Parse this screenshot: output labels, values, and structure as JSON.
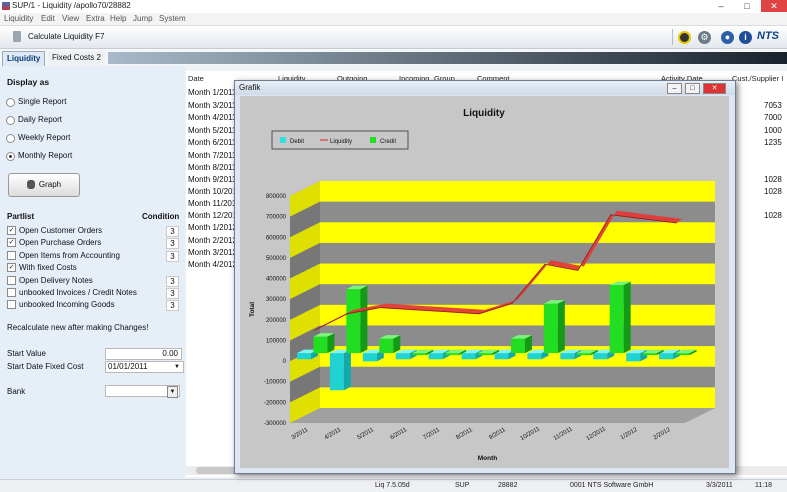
{
  "window": {
    "title": "SUP/1 - Liquidity /apollo70/28882",
    "minimize": "–",
    "maximize": "□",
    "close": "✕"
  },
  "menu": [
    "Liquidity",
    "Edit",
    "View",
    "Extra",
    "Help",
    "Jump",
    "System"
  ],
  "toolbar": {
    "command_label": "Calculate Liquidity F7",
    "brand": "NTS",
    "info_glyph": "i"
  },
  "tabs": [
    {
      "label": "Liquidity"
    },
    {
      "label": "Fixed Costs 2"
    }
  ],
  "left_panel": {
    "display_as_label": "Display as",
    "radios": [
      {
        "label": "Single Report",
        "selected": false
      },
      {
        "label": "Daily Report",
        "selected": false
      },
      {
        "label": "Weekly Report",
        "selected": false
      },
      {
        "label": "Monthly Report",
        "selected": true
      }
    ],
    "graph_button": "Graph",
    "partlist_label": "Partlist",
    "condition_label": "Condition",
    "partlist": [
      {
        "label": "Open Customer Orders",
        "checked": true,
        "condition": "3"
      },
      {
        "label": "Open Purchase Orders",
        "checked": true,
        "condition": "3"
      },
      {
        "label": "Open Items from Accounting",
        "checked": false,
        "condition": "3"
      },
      {
        "label": "With fixed Costs",
        "checked": true,
        "condition": ""
      },
      {
        "label": "Open Delivery Notes",
        "checked": false,
        "condition": "3"
      },
      {
        "label": "unbooked Invoices / Credit Notes",
        "checked": false,
        "condition": "3"
      },
      {
        "label": "unbooked Incoming Goods",
        "checked": false,
        "condition": "3"
      }
    ],
    "recalc_note": "Recalculate new after making Changes!",
    "start_value_label": "Start Value",
    "start_value": "0.00",
    "start_date_label": "Start Date Fixed Cost",
    "start_date": "01/01/2011",
    "bank_label": "Bank",
    "bank_value": ""
  },
  "table": {
    "columns": [
      "Date",
      "Liquidity",
      "Outgoing",
      "Incoming",
      "Group",
      "Comment",
      "Activity Date",
      "Cust./Supplier I"
    ],
    "rows": [
      {
        "date": "Month 1/2011",
        "cust": ""
      },
      {
        "date": "Month 3/2011",
        "cust": "7053"
      },
      {
        "date": "Month 4/2011",
        "cust": "7000"
      },
      {
        "date": "Month 5/2011",
        "cust": "1000"
      },
      {
        "date": "Month 6/2011",
        "cust": "1235"
      },
      {
        "date": "Month 7/2011",
        "cust": ""
      },
      {
        "date": "Month 8/2011",
        "cust": ""
      },
      {
        "date": "Month 9/2011",
        "cust": "1028"
      },
      {
        "date": "Month 10/2011",
        "cust": "1028"
      },
      {
        "date": "Month 11/2011",
        "cust": ""
      },
      {
        "date": "Month 12/2011",
        "cust": "1028"
      },
      {
        "date": "Month 1/2012",
        "cust": ""
      },
      {
        "date": "Month 2/2012",
        "cust": ""
      },
      {
        "date": "Month 3/2012",
        "cust": ""
      },
      {
        "date": "Month 4/2012",
        "cust": ""
      }
    ]
  },
  "status": {
    "version": "Liq 7.5.05d",
    "module": "SUP",
    "session": "28882",
    "company": "0001 NTS Software GmbH",
    "date": "3/3/2011",
    "time": "11:18"
  },
  "grafik": {
    "title": "Grafik",
    "min": "–",
    "max": "□",
    "close": "✕"
  },
  "colors": {
    "debit": "#2fe0e0",
    "liquidity": "#e03a3a",
    "credit": "#22dd22",
    "band_yellow": "#ffff00",
    "band_gray": "#8c8c8c"
  },
  "chart_data": {
    "type": "bar",
    "title": "Liquidity",
    "xlabel": "Month",
    "ylabel": "Total",
    "legend": [
      "Debit",
      "Liquidity",
      "Credit"
    ],
    "legend_position": "top-left",
    "categories": [
      "3/2011",
      "4/2011",
      "5/2011",
      "6/2011",
      "7/2011",
      "8/2011",
      "9/2011",
      "10/2011",
      "11/2011",
      "12/2011",
      "1/2012",
      "2/2012"
    ],
    "yticks": [
      "800000",
      "700000",
      "600000",
      "500000",
      "400000",
      "300000",
      "200000",
      "100000",
      "0",
      "-100000",
      "-200000",
      "-300000"
    ],
    "ylim": [
      -300000,
      800000
    ],
    "series": [
      {
        "name": "Debit",
        "type": "bar",
        "values": [
          -30000,
          -180000,
          -40000,
          -30000,
          -30000,
          -30000,
          -30000,
          -30000,
          -30000,
          -30000,
          -40000,
          -30000
        ]
      },
      {
        "name": "Credit",
        "type": "bar",
        "values": [
          80000,
          310000,
          70000,
          0,
          0,
          0,
          70000,
          240000,
          0,
          330000,
          0,
          0
        ]
      },
      {
        "name": "Liquidity",
        "type": "line",
        "values": [
          120000,
          200000,
          230000,
          220000,
          210000,
          200000,
          250000,
          440000,
          410000,
          680000,
          660000,
          640000
        ]
      }
    ]
  }
}
